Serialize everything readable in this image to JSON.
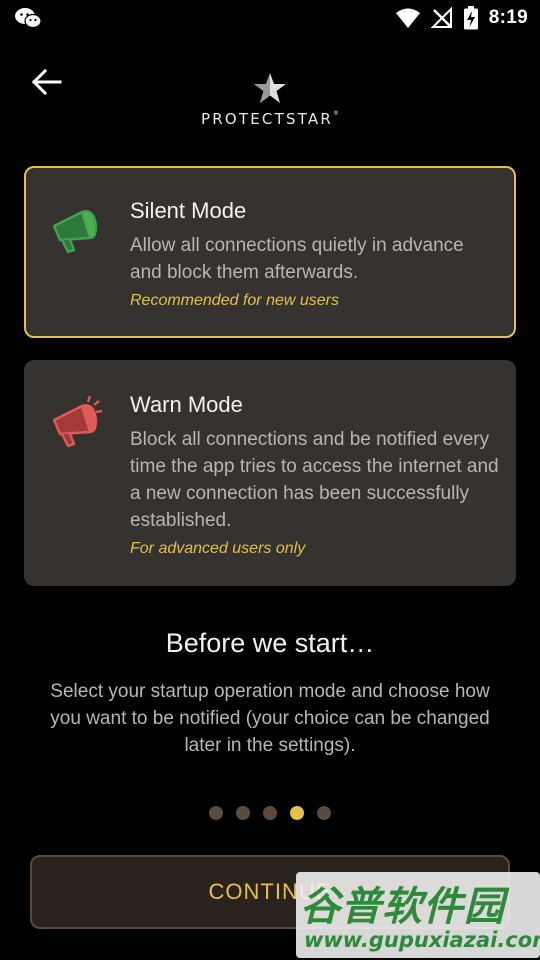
{
  "statusbar": {
    "time": "8:19",
    "icons": [
      "wechat-icon",
      "wifi-icon",
      "no-signal-icon",
      "battery-charging-icon"
    ]
  },
  "header": {
    "brand_name": "PROTECTSTAR",
    "brand_mark": "®",
    "back_icon": "back-arrow-icon"
  },
  "cards": {
    "silent": {
      "title": "Silent Mode",
      "description": "Allow all connections quietly in advance and block them afterwards.",
      "note": "Recommended for new users",
      "icon": "megaphone-icon",
      "color": "#4caf50",
      "selected": true
    },
    "warn": {
      "title": "Warn Mode",
      "description": "Block all connections and be notified every time the app tries to access the internet and a new connection has been successfully established.",
      "note": "For advanced users only",
      "icon": "megaphone-alert-icon",
      "color": "#e05a5a",
      "selected": false
    }
  },
  "intro": {
    "heading": "Before we start…",
    "text": "Select your startup operation mode and choose how you want to be notified (your choice can be changed later in the settings)."
  },
  "pager": {
    "count": 5,
    "active_index": 3
  },
  "actions": {
    "continue_label": "CONTINUE"
  },
  "watermark": {
    "cn_text": "谷普软件园",
    "url": "www.gupuxiazai.com"
  },
  "colors": {
    "accent": "#e3c049",
    "card_bg": "#353230",
    "background": "#000000"
  }
}
